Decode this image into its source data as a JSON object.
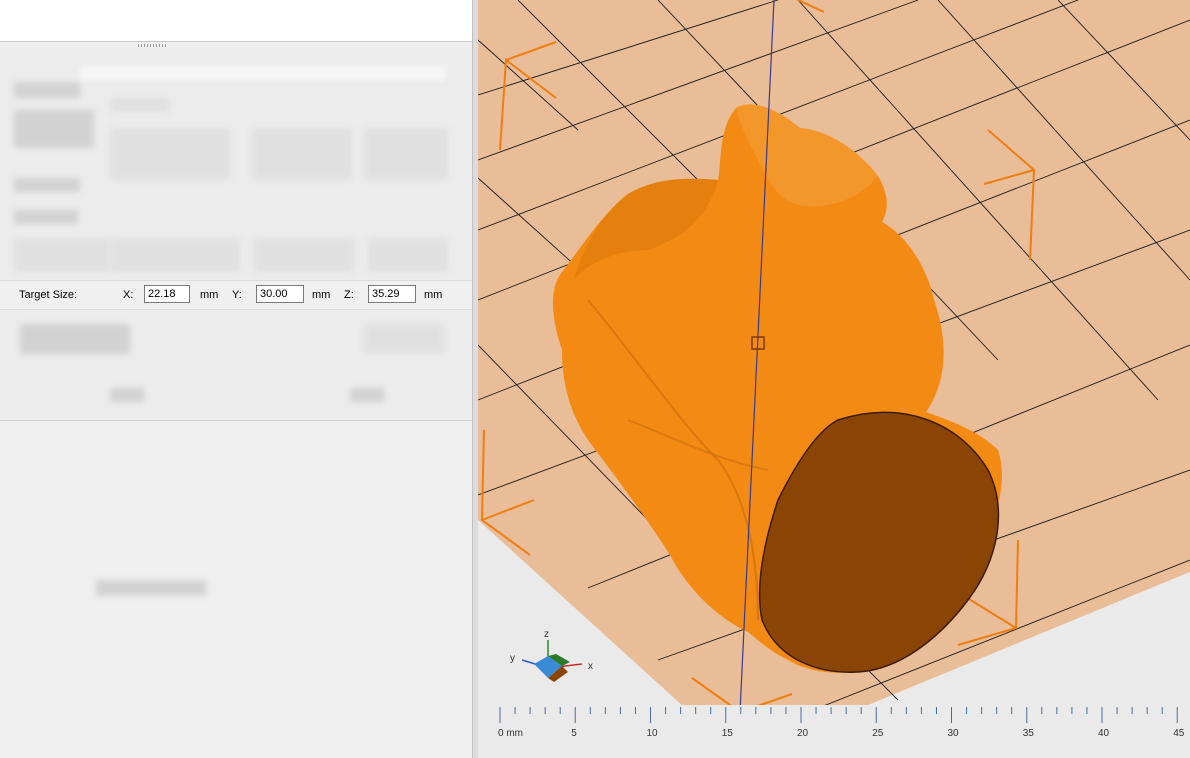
{
  "scale_panel": {
    "target_size_label": "Target Size:",
    "x_label": "X:",
    "x_value": "22.18",
    "y_label": "Y:",
    "y_value": "30.00",
    "z_label": "Z:",
    "z_value": "35.29",
    "unit": "mm"
  },
  "axis_gizmo": {
    "z": "z",
    "y": "y",
    "x": "x"
  },
  "ruler": {
    "labels": [
      "0 mm",
      "5",
      "10",
      "15",
      "20",
      "25",
      "30",
      "35",
      "40",
      "45"
    ]
  },
  "colors": {
    "model": "#f28a14",
    "bed": "#e9bd98",
    "cut_face": "#8a4504",
    "bounding_box": "#f07d10"
  }
}
